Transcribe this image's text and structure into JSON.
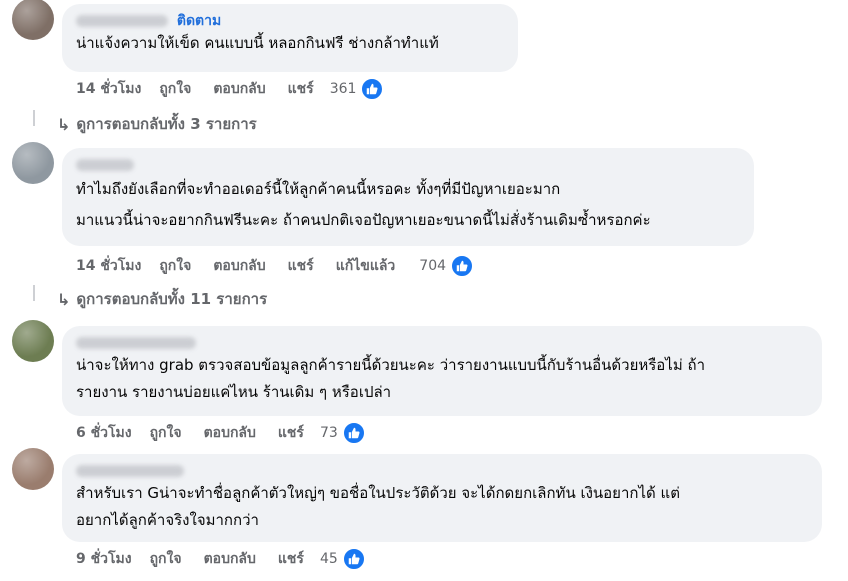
{
  "colors": {
    "bubble": "#f0f2f5",
    "meta_text": "#65676b",
    "link_blue": "#216fdb",
    "like_blue": "#1877f2"
  },
  "comments": [
    {
      "author_visible": "ติดตาม",
      "lines": [
        "น่าแจ้งความให้เข็ด คนแบบนี้ หลอกกินฟรี ช่างกล้าทำแท้"
      ],
      "time": "14 ชั่วโมง",
      "like_label": "ถูกใจ",
      "reply_label": "ตอบกลับ",
      "share_label": "แชร์",
      "edited_label": "",
      "likes": "361",
      "like_icon": "thumbs-up-icon"
    },
    {
      "author_visible": "",
      "lines": [
        "ทำไมถึงยังเลือกที่จะทำออเดอร์นี้ให้ลูกค้าคนนี้หรอคะ ทั้งๆที่มีปัญหาเยอะมาก",
        "มาแนวนี้น่าจะอยากกินฟรีนะคะ ถ้าคนปกติเจอปัญหาเยอะขนาดนี้ไม่สั่งร้านเดิมซ้ำหรอกค่ะ"
      ],
      "time": "14 ชั่วโมง",
      "like_label": "ถูกใจ",
      "reply_label": "ตอบกลับ",
      "share_label": "แชร์",
      "edited_label": "แก้ไขแล้ว",
      "likes": "704",
      "like_icon": "thumbs-up-icon"
    },
    {
      "author_visible": "",
      "lines": [
        "น่าจะให้ทาง grab ตรวจสอบข้อมูลลูกค้ารายนี้ด้วยนะคะ ว่ารายงานแบบนี้กับร้านอื่นด้วยหรือไม่ ถ้า",
        "รายงาน รายงานบ่อยแค่ไหน ร้านเดิม ๆ หรือเปล่า"
      ],
      "time": "6 ชั่วโมง",
      "like_label": "ถูกใจ",
      "reply_label": "ตอบกลับ",
      "share_label": "แชร์",
      "edited_label": "",
      "likes": "73",
      "like_icon": "thumbs-up-icon"
    },
    {
      "author_visible": "",
      "lines": [
        "สำหรับเรา Gน่าจะทำชื่อลูกค้าตัวใหญ่ๆ ขอชื่อในประวัติด้วย จะได้กดยกเลิกทัน เงินอยากได้ แต่",
        "อยากได้ลูกค้าจริงใจมากกว่า"
      ],
      "time": "9 ชั่วโมง",
      "like_label": "ถูกใจ",
      "reply_label": "ตอบกลับ",
      "share_label": "แชร์",
      "edited_label": "",
      "likes": "45",
      "like_icon": "thumbs-up-icon"
    }
  ],
  "reply_links": [
    {
      "label": "ดูการตอบกลับทั้ง 3 รายการ",
      "icon": "reply-arrow-icon"
    },
    {
      "label": "ดูการตอบกลับทั้ง 11 รายการ",
      "icon": "reply-arrow-icon"
    }
  ]
}
